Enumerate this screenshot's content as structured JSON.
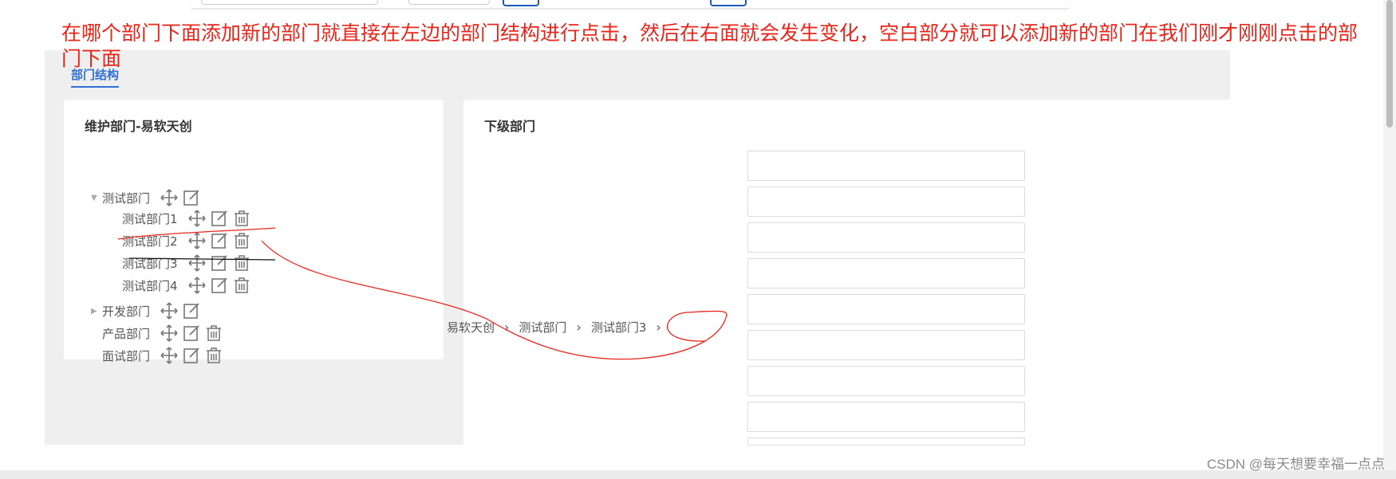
{
  "annotation_text": "在哪个部门下面添加新的部门就直接在左边的部门结构进行点击，然后在右面就会发生变化，空白部分就可以添加新的部门在我们刚才刚刚点击的部门下面",
  "tab_label": "部门结构",
  "left_panel": {
    "title": "维护部门-易软天创",
    "tree": [
      {
        "label": "测试部门",
        "level": 0,
        "expanded": true,
        "delete": false
      },
      {
        "label": "测试部门1",
        "level": 1,
        "delete": true
      },
      {
        "label": "测试部门2",
        "level": 1,
        "delete": true
      },
      {
        "label": "测试部门3",
        "level": 1,
        "delete": true
      },
      {
        "label": "测试部门4",
        "level": 1,
        "delete": true
      },
      {
        "label": "开发部门",
        "level": 0,
        "expanded": false,
        "delete": false
      },
      {
        "label": "产品部门",
        "level": 0,
        "delete": true
      },
      {
        "label": "面试部门",
        "level": 0,
        "delete": true
      }
    ]
  },
  "right_panel": {
    "title": "下级部门",
    "breadcrumb": [
      "易软天创",
      "测试部门",
      "测试部门3"
    ],
    "input_count": 9
  },
  "watermark": "CSDN @每天想要幸福一点点",
  "colors": {
    "accent": "#2f6fd6",
    "annotation": "#e8261c"
  }
}
